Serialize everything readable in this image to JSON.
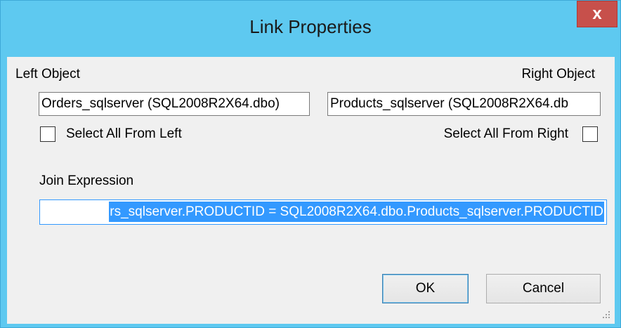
{
  "window": {
    "title": "Link Properties",
    "close_glyph": "x"
  },
  "left": {
    "label": "Left Object",
    "value": "Orders_sqlserver (SQL2008R2X64.dbo)",
    "select_all_label": "Select All From Left",
    "select_all_checked": false
  },
  "right": {
    "label": "Right Object",
    "value": "Products_sqlserver (SQL2008R2X64.db",
    "select_all_label": "Select All From Right",
    "select_all_checked": false
  },
  "join": {
    "label": "Join Expression",
    "value": "rs_sqlserver.PRODUCTID = SQL2008R2X64.dbo.Products_sqlserver.PRODUCTID"
  },
  "buttons": {
    "ok": "OK",
    "cancel": "Cancel"
  },
  "colors": {
    "title_bar": "#5ec9f0",
    "close_button": "#c7504b",
    "selection": "#3399ff",
    "client_bg": "#f0f0f0"
  }
}
